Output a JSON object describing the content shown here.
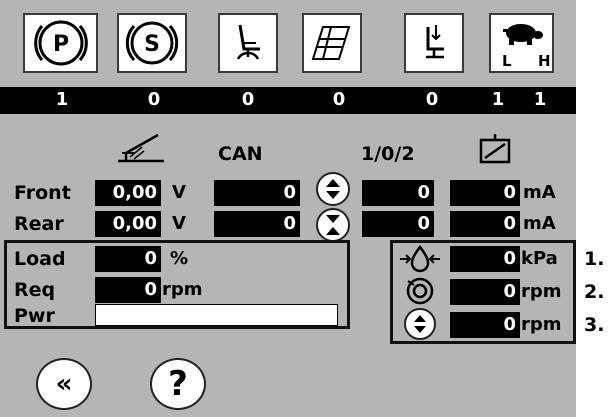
{
  "indicators": [
    {
      "name": "parking-brake",
      "icon": "parking-brake-icon",
      "text": "P"
    },
    {
      "name": "seat-switch",
      "icon": "service-s-icon",
      "text": "S"
    },
    {
      "name": "operator-seat",
      "icon": "seat-icon"
    },
    {
      "name": "grid-mode",
      "icon": "grid-icon"
    },
    {
      "name": "seat-presence",
      "icon": "seat-presence-icon"
    },
    {
      "name": "speed-range",
      "icon": "turtle-icon",
      "low": "L",
      "high": "H"
    }
  ],
  "status_bar": [
    "1",
    "0",
    "0",
    "0",
    "0",
    "1",
    "1"
  ],
  "headers": {
    "can": "CAN",
    "io": "1/0/2"
  },
  "pedal": {
    "front_label": "Front",
    "rear_label": "Rear",
    "front_volt": "0,00",
    "rear_volt": "0,00",
    "volt_unit": "V",
    "front_can": "0",
    "rear_can": "0",
    "front_io": "0",
    "rear_io": "0",
    "front_ma": "0",
    "rear_ma": "0",
    "ma_unit": "mA"
  },
  "engine": {
    "load_label": "Load",
    "load_value": "0",
    "load_unit": "%",
    "req_label": "Req",
    "req_value": "0",
    "req_unit": "rpm",
    "pwr_label": "Pwr",
    "pwr_value": ""
  },
  "sensors": [
    {
      "value": "0",
      "unit": "kPa",
      "number": "1."
    },
    {
      "value": "0",
      "unit": "rpm",
      "number": "2."
    },
    {
      "value": "0",
      "unit": "rpm",
      "number": "3."
    }
  ],
  "nav": {
    "back": "«",
    "help": "?"
  }
}
